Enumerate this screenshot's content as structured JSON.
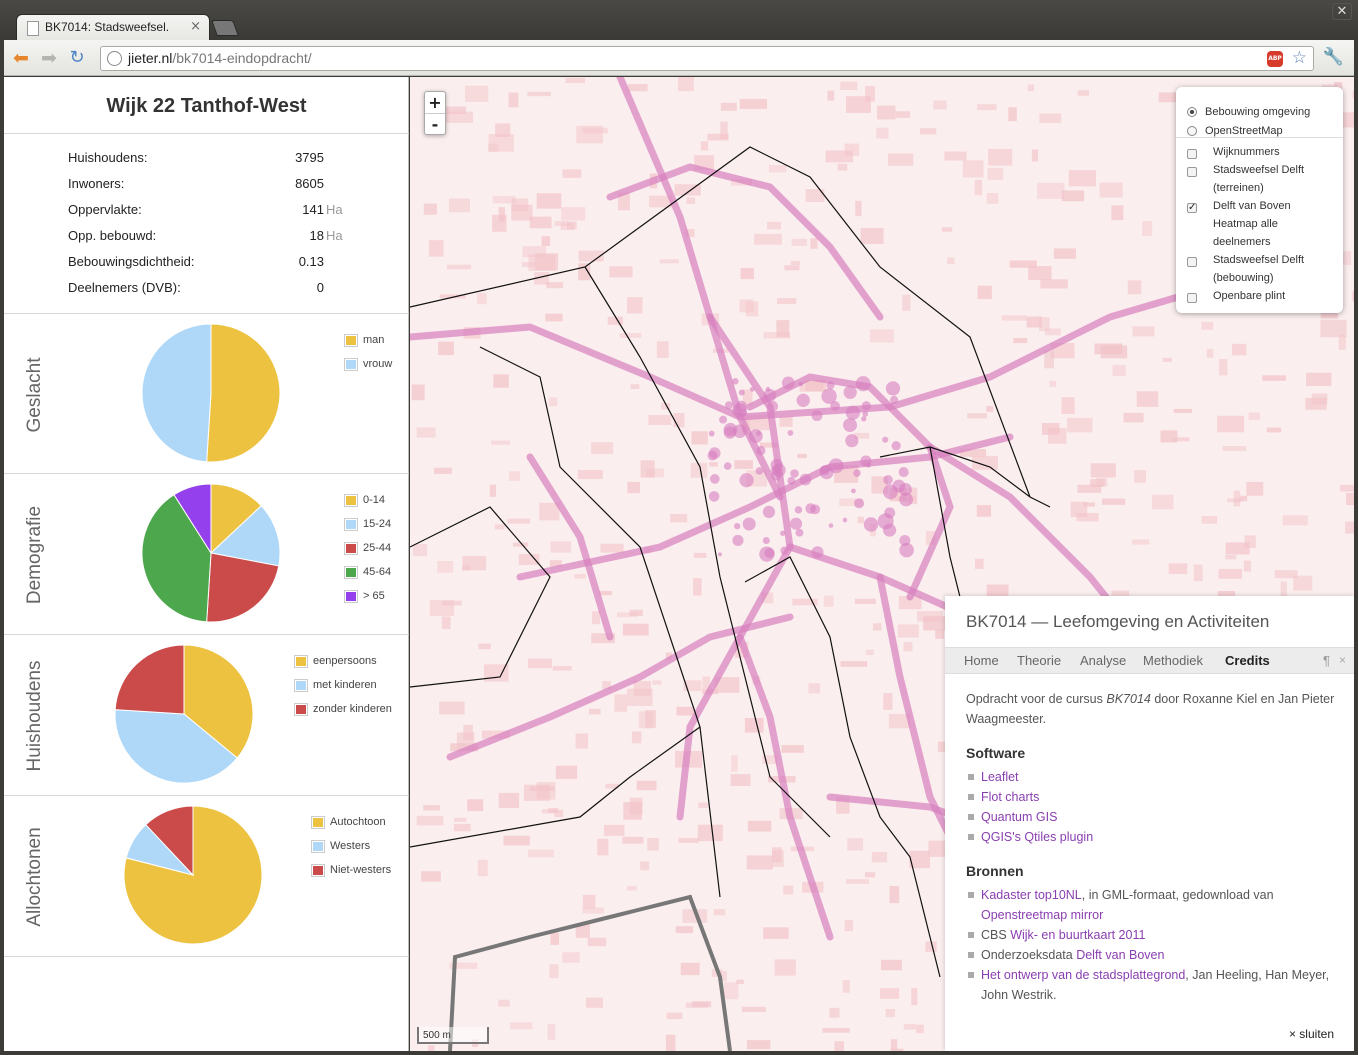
{
  "browser": {
    "tab_title": "BK7014: Stadsweefsel.",
    "url_host": "jieter.nl",
    "url_path": "/bk7014-eindopdracht/",
    "adblock_label": "ABP"
  },
  "sidebar": {
    "title": "Wijk 22 Tanthof-West",
    "stats": [
      {
        "label": "Huishoudens:",
        "value": "3795",
        "unit": ""
      },
      {
        "label": "Inwoners:",
        "value": "8605",
        "unit": ""
      },
      {
        "label": "Oppervlakte:",
        "value": "141",
        "unit": "Ha"
      },
      {
        "label": "Opp. bebouwd:",
        "value": "18",
        "unit": "Ha"
      },
      {
        "label": "Bebouwingsdichtheid:",
        "value": "0.13",
        "unit": ""
      },
      {
        "label": "Deelnemers (DVB):",
        "value": "0",
        "unit": ""
      }
    ]
  },
  "chart_data": [
    {
      "type": "pie",
      "title": "Geslacht",
      "categories": [
        "man",
        "vrouw"
      ],
      "values": [
        51,
        49
      ],
      "colors": [
        "#edc240",
        "#afd8f8"
      ]
    },
    {
      "type": "pie",
      "title": "Demografie",
      "categories": [
        "0-14",
        "15-24",
        "25-44",
        "45-64",
        "> 65"
      ],
      "values": [
        13,
        15,
        23,
        40,
        9
      ],
      "colors": [
        "#edc240",
        "#afd8f8",
        "#cb4b4b",
        "#4da74d",
        "#9440ed"
      ]
    },
    {
      "type": "pie",
      "title": "Huishoudens",
      "categories": [
        "eenpersoons",
        "met kinderen",
        "zonder kinderen"
      ],
      "values": [
        36,
        40,
        24
      ],
      "colors": [
        "#edc240",
        "#afd8f8",
        "#cb4b4b"
      ]
    },
    {
      "type": "pie",
      "title": "Allochtonen",
      "categories": [
        "Autochtoon",
        "Westers",
        "Niet-westers"
      ],
      "values": [
        79,
        9,
        12
      ],
      "colors": [
        "#edc240",
        "#afd8f8",
        "#cb4b4b"
      ]
    }
  ],
  "map": {
    "zoom_in": "+",
    "zoom_out": "-",
    "scale": "500 m",
    "base_layers": [
      {
        "label": "Bebouwing omgeving",
        "selected": true
      },
      {
        "label": "OpenStreetMap",
        "selected": false
      }
    ],
    "overlays": [
      {
        "lines": [
          "Wijknummers"
        ],
        "checked": false
      },
      {
        "lines": [
          "Stadsweefsel Delft",
          "(terreinen)"
        ],
        "checked": false
      },
      {
        "lines": [
          "Delft van Boven",
          "Heatmap alle",
          "deelnemers"
        ],
        "checked": true
      },
      {
        "lines": [
          "Stadsweefsel Delft",
          "(bebouwing)"
        ],
        "checked": false
      },
      {
        "lines": [
          "Openbare plint"
        ],
        "checked": false
      }
    ],
    "colors": {
      "background": "#fbeeee",
      "heat": "#d77fbf",
      "roads": "#f2c4c9"
    }
  },
  "panel": {
    "title": "BK7014 — Leefomgeving en Activiteiten",
    "tabs": [
      "Home",
      "Theorie",
      "Analyse",
      "Methodiek",
      "Credits"
    ],
    "active_tab": "Credits",
    "pilcrow": "¶",
    "close": "×",
    "intro_pre": "Opdracht voor de cursus ",
    "intro_course": "BK7014",
    "intro_post": " door Roxanne Kiel en Jan Pieter Waagmeester.",
    "software_heading": "Software",
    "software": [
      "Leaflet",
      "Flot charts",
      "Quantum GIS",
      "QGIS's Qtiles plugin"
    ],
    "sources_heading": "Bronnen",
    "src1_link": "Kadaster top10NL",
    "src1_text": ", in GML-formaat, gedownload van ",
    "src1_link2": "Openstreetmap mirror",
    "src2_text": "CBS ",
    "src2_link": "Wijk- en buurtkaart 2011",
    "src3_text": "Onderzoeksdata ",
    "src3_link": "Delft van Boven",
    "src4_link": "Het ontwerp van de stadsplattegrond",
    "src4_text": ", Jan Heeling, Han Meyer, John Westrik.",
    "sluiten": "× sluiten"
  }
}
